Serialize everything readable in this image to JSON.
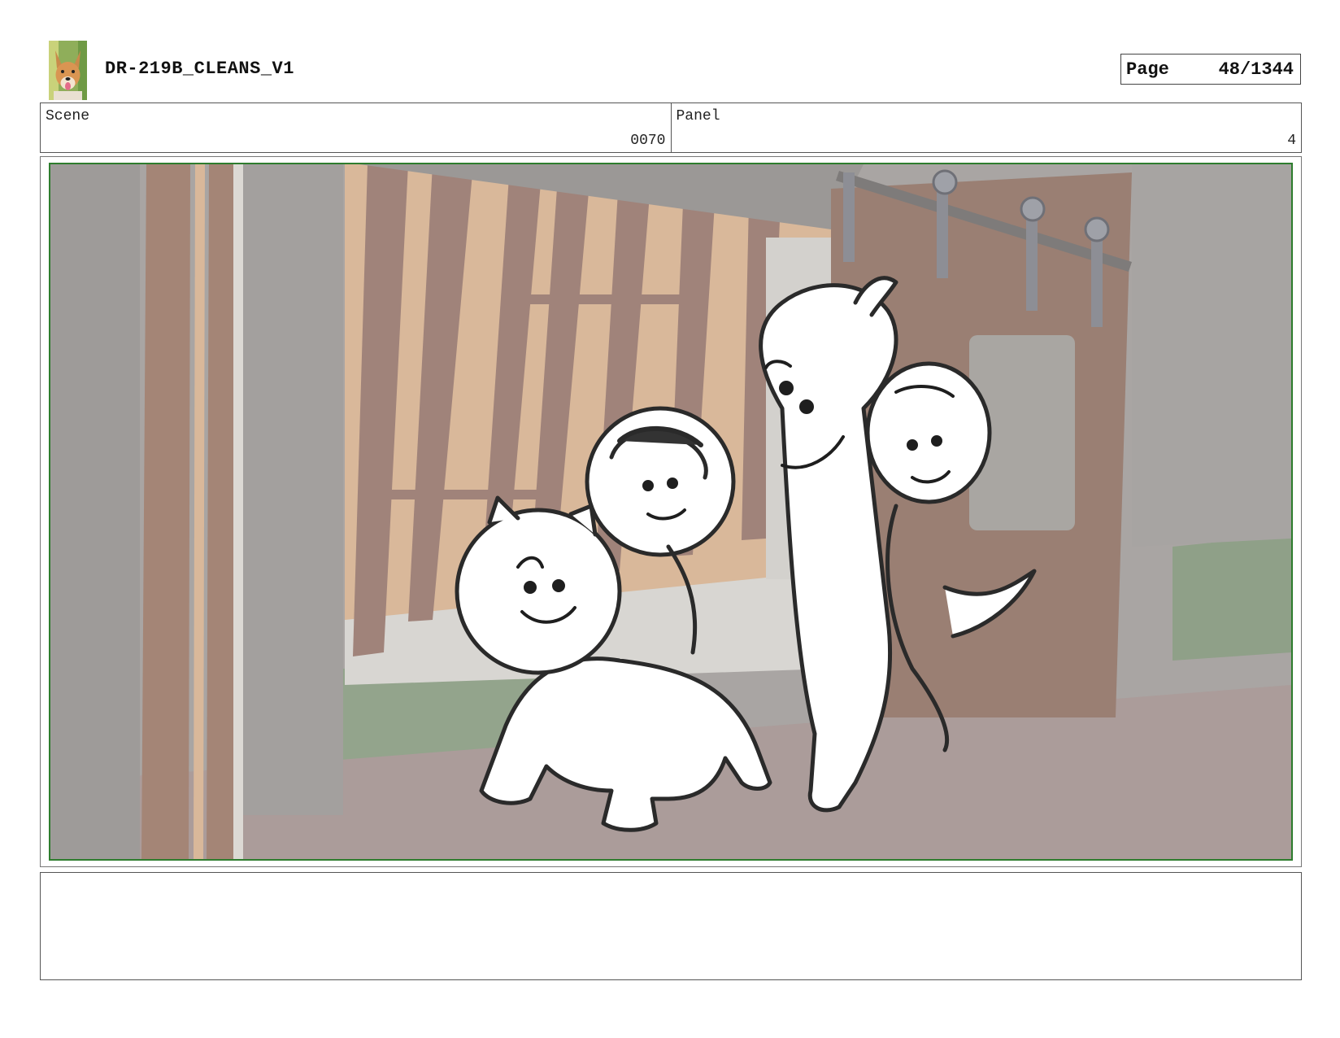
{
  "header": {
    "title": "DR-219B_CLEANS_V1",
    "page_label": "Page",
    "page_number": "48/1344"
  },
  "info": {
    "scene_label": "Scene",
    "scene_value": "0070",
    "panel_label": "Panel",
    "panel_value": "4"
  },
  "notes": {
    "text": ""
  },
  "colors": {
    "frame_green": "#2e7d2e",
    "wall_peach": "#d9b89a",
    "wall_brown": "#9a7f73",
    "ground": "#a89a98",
    "grass": "#93a48c"
  },
  "icons": {
    "logo": "dog-logo-icon"
  }
}
